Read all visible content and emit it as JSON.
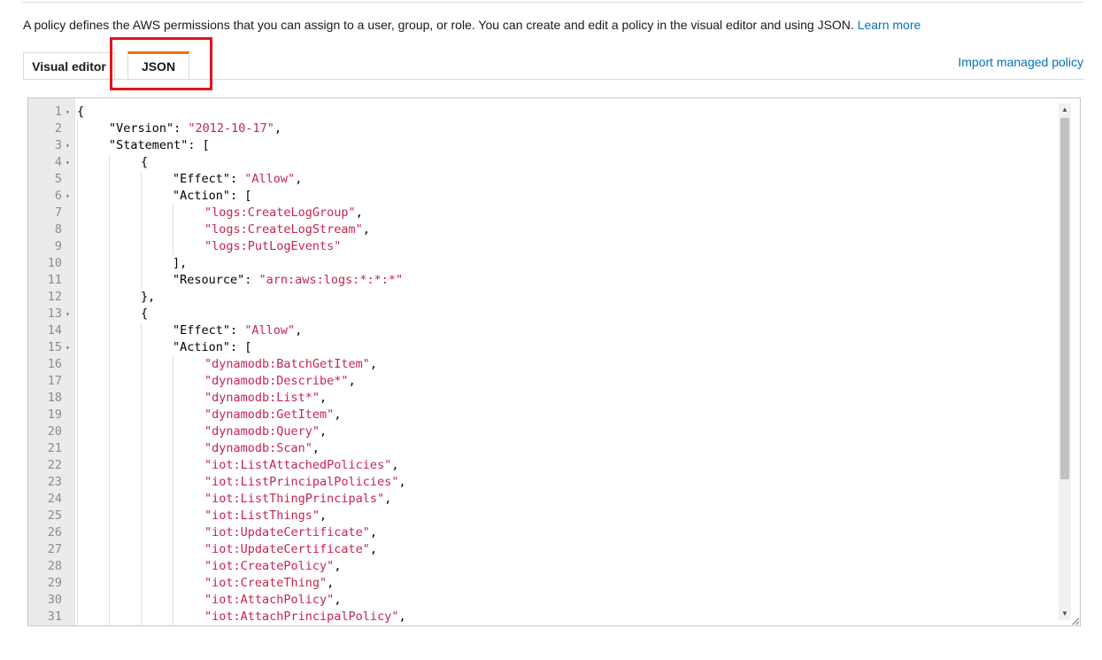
{
  "intro": {
    "text": "A policy defines the AWS permissions that you can assign to a user, group, or role. You can create and edit a policy in the visual editor and using JSON. ",
    "learn_more": "Learn more"
  },
  "tabs": [
    {
      "label": "Visual editor",
      "active": false
    },
    {
      "label": "JSON",
      "active": true
    }
  ],
  "import_link": "Import managed policy",
  "editor": {
    "lines": [
      {
        "n": "1",
        "fold": true,
        "indent": 0,
        "parts": [
          [
            "p",
            "{"
          ]
        ]
      },
      {
        "n": "2",
        "fold": false,
        "indent": 1,
        "parts": [
          [
            "p",
            "\"Version\": "
          ],
          [
            "s",
            "\"2012-10-17\""
          ],
          [
            "p",
            ","
          ]
        ]
      },
      {
        "n": "3",
        "fold": true,
        "indent": 1,
        "parts": [
          [
            "p",
            "\"Statement\": ["
          ]
        ]
      },
      {
        "n": "4",
        "fold": true,
        "indent": 2,
        "parts": [
          [
            "p",
            "{"
          ]
        ]
      },
      {
        "n": "5",
        "fold": false,
        "indent": 3,
        "parts": [
          [
            "p",
            "\"Effect\": "
          ],
          [
            "s",
            "\"Allow\""
          ],
          [
            "p",
            ","
          ]
        ]
      },
      {
        "n": "6",
        "fold": true,
        "indent": 3,
        "parts": [
          [
            "p",
            "\"Action\": ["
          ]
        ]
      },
      {
        "n": "7",
        "fold": false,
        "indent": 4,
        "parts": [
          [
            "s",
            "\"logs:CreateLogGroup\""
          ],
          [
            "p",
            ","
          ]
        ]
      },
      {
        "n": "8",
        "fold": false,
        "indent": 4,
        "parts": [
          [
            "s",
            "\"logs:CreateLogStream\""
          ],
          [
            "p",
            ","
          ]
        ]
      },
      {
        "n": "9",
        "fold": false,
        "indent": 4,
        "parts": [
          [
            "s",
            "\"logs:PutLogEvents\""
          ]
        ]
      },
      {
        "n": "10",
        "fold": false,
        "indent": 3,
        "parts": [
          [
            "p",
            "],"
          ]
        ]
      },
      {
        "n": "11",
        "fold": false,
        "indent": 3,
        "parts": [
          [
            "p",
            "\"Resource\": "
          ],
          [
            "s",
            "\"arn:aws:logs:*:*:*\""
          ]
        ]
      },
      {
        "n": "12",
        "fold": false,
        "indent": 2,
        "parts": [
          [
            "p",
            "},"
          ]
        ]
      },
      {
        "n": "13",
        "fold": true,
        "indent": 2,
        "parts": [
          [
            "p",
            "{"
          ]
        ]
      },
      {
        "n": "14",
        "fold": false,
        "indent": 3,
        "parts": [
          [
            "p",
            "\"Effect\": "
          ],
          [
            "s",
            "\"Allow\""
          ],
          [
            "p",
            ","
          ]
        ]
      },
      {
        "n": "15",
        "fold": true,
        "indent": 3,
        "parts": [
          [
            "p",
            "\"Action\": ["
          ]
        ]
      },
      {
        "n": "16",
        "fold": false,
        "indent": 4,
        "parts": [
          [
            "s",
            "\"dynamodb:BatchGetItem\""
          ],
          [
            "p",
            ","
          ]
        ]
      },
      {
        "n": "17",
        "fold": false,
        "indent": 4,
        "parts": [
          [
            "s",
            "\"dynamodb:Describe*\""
          ],
          [
            "p",
            ","
          ]
        ]
      },
      {
        "n": "18",
        "fold": false,
        "indent": 4,
        "parts": [
          [
            "s",
            "\"dynamodb:List*\""
          ],
          [
            "p",
            ","
          ]
        ]
      },
      {
        "n": "19",
        "fold": false,
        "indent": 4,
        "parts": [
          [
            "s",
            "\"dynamodb:GetItem\""
          ],
          [
            "p",
            ","
          ]
        ]
      },
      {
        "n": "20",
        "fold": false,
        "indent": 4,
        "parts": [
          [
            "s",
            "\"dynamodb:Query\""
          ],
          [
            "p",
            ","
          ]
        ]
      },
      {
        "n": "21",
        "fold": false,
        "indent": 4,
        "parts": [
          [
            "s",
            "\"dynamodb:Scan\""
          ],
          [
            "p",
            ","
          ]
        ]
      },
      {
        "n": "22",
        "fold": false,
        "indent": 4,
        "parts": [
          [
            "s",
            "\"iot:ListAttachedPolicies\""
          ],
          [
            "p",
            ","
          ]
        ]
      },
      {
        "n": "23",
        "fold": false,
        "indent": 4,
        "parts": [
          [
            "s",
            "\"iot:ListPrincipalPolicies\""
          ],
          [
            "p",
            ","
          ]
        ]
      },
      {
        "n": "24",
        "fold": false,
        "indent": 4,
        "parts": [
          [
            "s",
            "\"iot:ListThingPrincipals\""
          ],
          [
            "p",
            ","
          ]
        ]
      },
      {
        "n": "25",
        "fold": false,
        "indent": 4,
        "parts": [
          [
            "s",
            "\"iot:ListThings\""
          ],
          [
            "p",
            ","
          ]
        ]
      },
      {
        "n": "26",
        "fold": false,
        "indent": 4,
        "parts": [
          [
            "s",
            "\"iot:UpdateCertificate\""
          ],
          [
            "p",
            ","
          ]
        ]
      },
      {
        "n": "27",
        "fold": false,
        "indent": 4,
        "parts": [
          [
            "s",
            "\"iot:UpdateCertificate\""
          ],
          [
            "p",
            ","
          ]
        ]
      },
      {
        "n": "28",
        "fold": false,
        "indent": 4,
        "parts": [
          [
            "s",
            "\"iot:CreatePolicy\""
          ],
          [
            "p",
            ","
          ]
        ]
      },
      {
        "n": "29",
        "fold": false,
        "indent": 4,
        "parts": [
          [
            "s",
            "\"iot:CreateThing\""
          ],
          [
            "p",
            ","
          ]
        ]
      },
      {
        "n": "30",
        "fold": false,
        "indent": 4,
        "parts": [
          [
            "s",
            "\"iot:AttachPolicy\""
          ],
          [
            "p",
            ","
          ]
        ]
      },
      {
        "n": "31",
        "fold": false,
        "indent": 4,
        "parts": [
          [
            "s",
            "\"iot:AttachPrincipalPolicy\""
          ],
          [
            "p",
            ","
          ]
        ]
      }
    ]
  },
  "colors": {
    "accent_tab": "#ec7211",
    "link": "#0073bb",
    "highlight": "#e0151f",
    "string": "#c7254e"
  }
}
